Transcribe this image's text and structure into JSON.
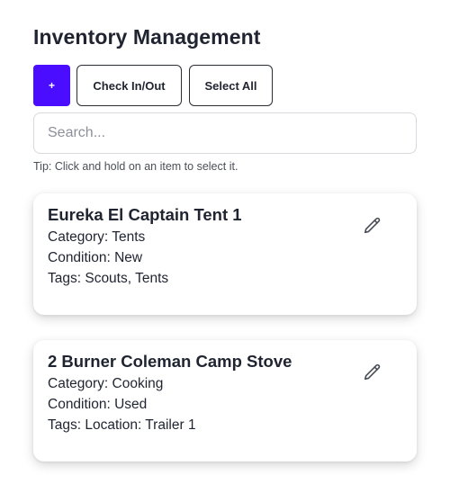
{
  "header": {
    "title": "Inventory Management"
  },
  "toolbar": {
    "add_label": "+",
    "check_label": "Check In/Out",
    "select_all_label": "Select All"
  },
  "search": {
    "placeholder": "Search...",
    "value": ""
  },
  "tip": "Tip: Click and hold on an item to select it.",
  "items": [
    {
      "name": "Eureka El Captain Tent 1",
      "category": "Category: Tents",
      "condition": "Condition: New",
      "tags": "Tags: Scouts, Tents",
      "edit_icon": "pencil-icon"
    },
    {
      "name": "2 Burner Coleman Camp Stove",
      "category": "Category: Cooking",
      "condition": "Condition: Used",
      "tags": "Tags: Location: Trailer 1",
      "edit_icon": "pencil-icon"
    }
  ],
  "colors": {
    "accent": "#4b0dff",
    "text": "#1f2430",
    "border": "#2a2d33",
    "icon": "#4a4f57"
  }
}
